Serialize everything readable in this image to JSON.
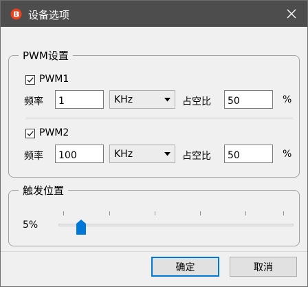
{
  "window": {
    "title": "设备选项",
    "icon": "app-logo-icon",
    "close_icon": "close-icon"
  },
  "pwm_group": {
    "title": "PWM设置",
    "pwm1": {
      "checkbox_label": "PWM1",
      "checked": true,
      "freq_label": "频率",
      "freq_value": "1",
      "unit": "KHz",
      "duty_label": "占空比",
      "duty_value": "50",
      "percent": "%"
    },
    "pwm2": {
      "checkbox_label": "PWM2",
      "checked": true,
      "freq_label": "频率",
      "freq_value": "100",
      "unit": "KHz",
      "duty_label": "占空比",
      "duty_value": "50",
      "percent": "%"
    }
  },
  "trigger_group": {
    "title": "触发位置",
    "value_text": "5%",
    "value": 0.05
  },
  "buttons": {
    "ok": "确定",
    "cancel": "取消"
  },
  "colors": {
    "titlebar": "#4d4d4d",
    "accent": "#0078d7",
    "logo": "#e8421e"
  }
}
